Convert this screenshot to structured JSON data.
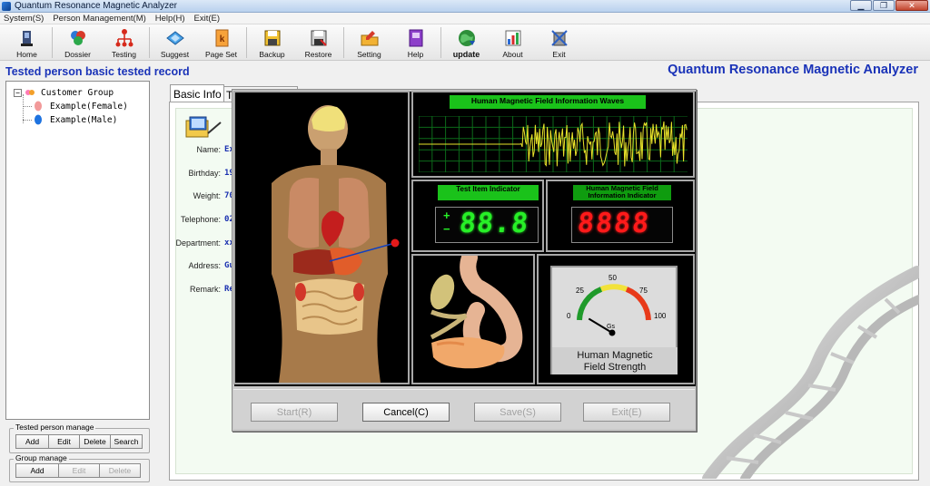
{
  "window": {
    "title": "Quantum Resonance Magnetic Analyzer",
    "min": "▁",
    "max": "❐",
    "close": "✕"
  },
  "menu": [
    "System(S)",
    "Person Management(M)",
    "Help(H)",
    "Exit(E)"
  ],
  "toolbar": [
    {
      "label": "Home",
      "icon": "home-icon"
    },
    {
      "label": "Dossier",
      "icon": "dossier-icon"
    },
    {
      "label": "Testing",
      "icon": "testing-icon"
    },
    {
      "label": "Suggest",
      "icon": "suggest-icon"
    },
    {
      "label": "Page Set",
      "icon": "page-set-icon"
    },
    {
      "label": "Backup",
      "icon": "backup-icon"
    },
    {
      "label": "Restore",
      "icon": "restore-icon"
    },
    {
      "label": "Setting",
      "icon": "setting-icon"
    },
    {
      "label": "Help",
      "icon": "help-icon"
    },
    {
      "label": "update",
      "icon": "update-icon"
    },
    {
      "label": "About",
      "icon": "about-icon"
    },
    {
      "label": "Exit",
      "icon": "exit-icon"
    }
  ],
  "header": {
    "record_title": "Tested person basic tested record",
    "brand": "Quantum Resonance Magnetic Analyzer"
  },
  "tree": {
    "root": "Customer Group",
    "expander": "−",
    "items": [
      "Example(Female)",
      "Example(Male)"
    ]
  },
  "tested_person_manage": {
    "legend": "Tested person manage",
    "buttons": [
      "Add",
      "Edit",
      "Delete",
      "Search"
    ]
  },
  "group_manage": {
    "legend": "Group manage",
    "buttons": [
      "Add",
      "Edit",
      "Delete"
    ]
  },
  "tabs": [
    {
      "label": "Basic Info"
    },
    {
      "label": "T"
    }
  ],
  "fields": [
    {
      "label": "Name:",
      "value": "Ex"
    },
    {
      "label": "Birthday:",
      "value": "19"
    },
    {
      "label": "Weight:",
      "value": "70"
    },
    {
      "label": "Telephone:",
      "value": "02"
    },
    {
      "label": "Department:",
      "value": "xx"
    },
    {
      "label": "Address:",
      "value": "Gu"
    },
    {
      "label": "Remark:",
      "value": "Re"
    }
  ],
  "dialog": {
    "wave_title": "Human Magnetic Field Information Waves",
    "test_item_title": "Test Item Indicator",
    "test_item_sign_plus": "+",
    "test_item_sign_minus": "−",
    "test_item_value": "88.8",
    "field_info_title_1": "Human Magnetic Field",
    "field_info_title_2": "Information Indicator",
    "field_info_value": "8888",
    "gauge": {
      "ticks": [
        "0",
        "25",
        "50",
        "75",
        "100"
      ],
      "unit": "Gs",
      "value": 12
    },
    "gauge_caption_1": "Human Magnetic",
    "gauge_caption_2": "Field Strength",
    "buttons": [
      {
        "label": "Start(R)",
        "enabled": false
      },
      {
        "label": "Cancel(C)",
        "enabled": true
      },
      {
        "label": "Save(S)",
        "enabled": false
      },
      {
        "label": "Exit(E)",
        "enabled": false
      }
    ]
  },
  "colors": {
    "accent_blue": "#1a33b8",
    "indicator_green": "#27f027",
    "indicator_red": "#ff1a1a"
  }
}
